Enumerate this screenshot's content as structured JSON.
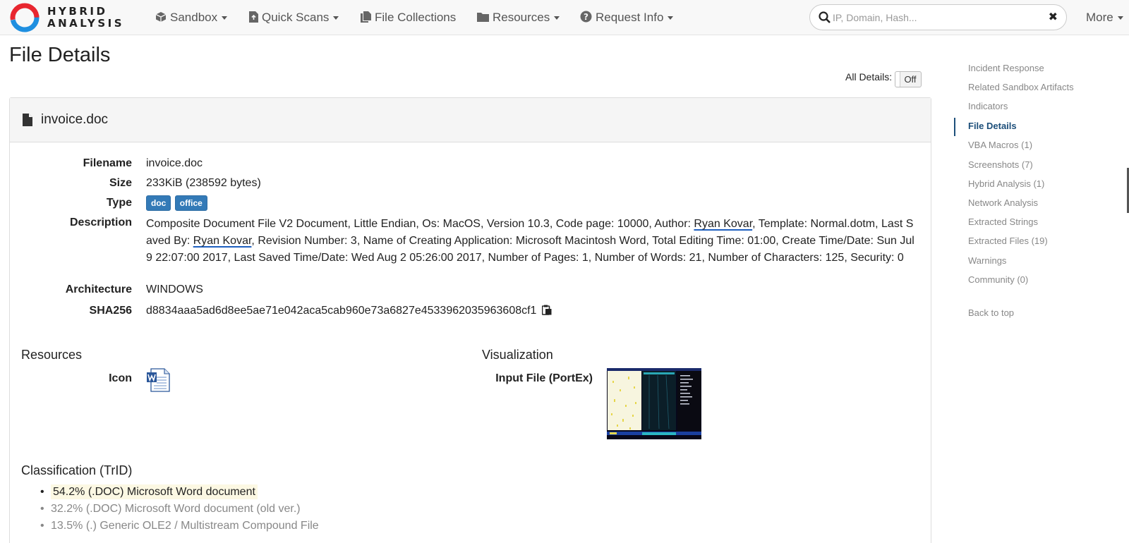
{
  "brand": {
    "line1": "HYBRID",
    "line2": "ANALYSIS"
  },
  "nav": {
    "sandbox": "Sandbox",
    "quick_scans": "Quick Scans",
    "file_collections": "File Collections",
    "resources": "Resources",
    "request_info": "Request Info",
    "more": "More"
  },
  "search": {
    "placeholder": "IP, Domain, Hash...",
    "clear": "✖"
  },
  "page_title": "File Details",
  "all_details": {
    "label": "All Details:",
    "toggle": "Off"
  },
  "file": {
    "name": "invoice.doc",
    "labels": {
      "filename": "Filename",
      "size": "Size",
      "type": "Type",
      "description": "Description",
      "architecture": "Architecture",
      "sha256": "SHA256"
    },
    "filename": "invoice.doc",
    "size": "233KiB (238592 bytes)",
    "types": [
      "doc",
      "office"
    ],
    "description": {
      "p1": "Composite Document File V2 Document, Little Endian, Os: MacOS, Version 10.3, Code page: 10000, Author: ",
      "author1": "Ryan Kovar",
      "p2": ", Template: Normal.dotm, Last Saved By: ",
      "author2": "Ryan Kovar",
      "p3": ", Revision Number: 3, Name of Creating Application: Microsoft Macintosh Word, Total Editing Time: 01:00, Create Time/Date: Sun Jul 9 22:07:00 2017, Last Saved Time/Date: Wed Aug 2 05:26:00 2017, Number of Pages: 1, Number of Words: 21, Number of Characters: 125, Security: 0"
    },
    "architecture": "WINDOWS",
    "sha256": "d8834aaa5ad6d8ee5ae71e042aca5cab960e73a6827e4533962035963608cf1"
  },
  "resources": {
    "title": "Resources",
    "icon_label": "Icon"
  },
  "visualization": {
    "title": "Visualization",
    "input_label": "Input File (PortEx)"
  },
  "classification": {
    "title": "Classification (TrID)",
    "items": [
      "54.2% (.DOC) Microsoft Word document",
      "32.2% (.DOC) Microsoft Word document (old ver.)",
      "13.5% (.) Generic OLE2 / Multistream Compound File"
    ]
  },
  "sidebar": {
    "items": [
      "Incident Response",
      "Related Sandbox Artifacts",
      "Indicators",
      "File Details",
      "VBA Macros (1)",
      "Screenshots (7)",
      "Hybrid Analysis (1)",
      "Network Analysis",
      "Extracted Strings",
      "Extracted Files (19)",
      "Warnings",
      "Community (0)"
    ],
    "active_index": 3,
    "back_to_top": "Back to top"
  },
  "colors": {
    "accent_blue": "#337ab7",
    "brand_red": "#e8262f",
    "brand_blue": "#1f8fe0",
    "sidebar_active": "#1d4f7a",
    "highlight": "#fcf8e3"
  }
}
